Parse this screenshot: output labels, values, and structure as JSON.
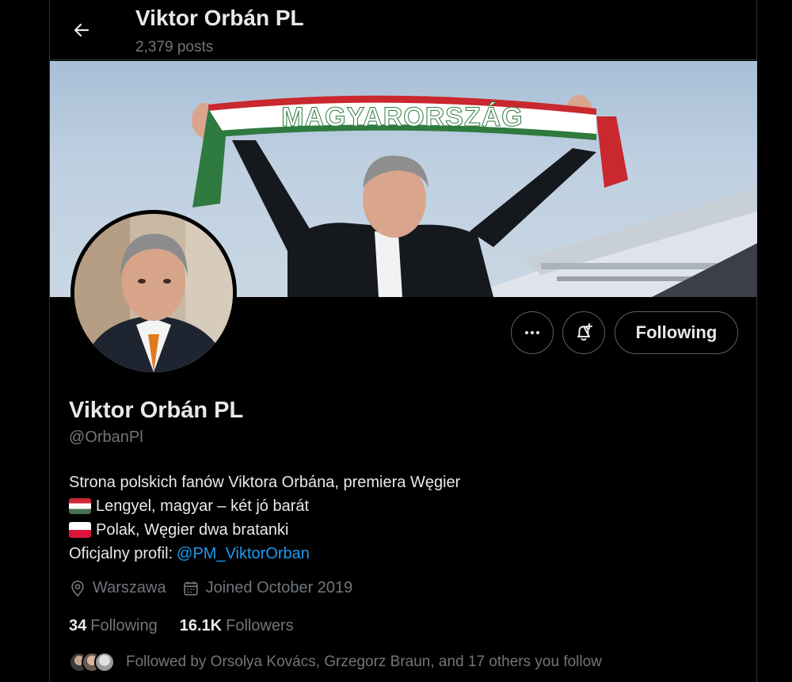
{
  "header": {
    "title": "Viktor Orbán PL",
    "posts_count": "2,379 posts"
  },
  "banner": {
    "scarf_text": "MAGYARORSZÁG"
  },
  "actions": {
    "following_label": "Following"
  },
  "profile": {
    "display_name": "Viktor Orbán PL",
    "handle": "@OrbanPl",
    "bio": {
      "line1": "Strona polskich fanów Viktora Orbána, premiera  Węgier",
      "line2": "Lengyel, magyar – két jó barát",
      "line3": "Polak, Węgier dwa bratanki",
      "line4_prefix": "Oficjalny profil:",
      "line4_link": "@PM_ViktorOrban"
    },
    "location": "Warszawa",
    "joined": "Joined October 2019",
    "following_count": "34",
    "following_label": "Following",
    "followers_count": "16.1K",
    "followers_label": "Followers",
    "followed_by": "Followed by Orsolya Kovács, Grzegorz Braun, and 17 others you follow"
  },
  "colors": {
    "background": "#000000",
    "primary_text": "#e7e9ea",
    "secondary_text": "#71767b",
    "link": "#1d9bf0",
    "border": "#2f3336"
  },
  "icons": {
    "back": "arrow-left-icon",
    "more": "more-horizontal-icon",
    "notifications": "bell-plus-icon",
    "location": "location-pin-icon",
    "calendar": "calendar-icon"
  }
}
